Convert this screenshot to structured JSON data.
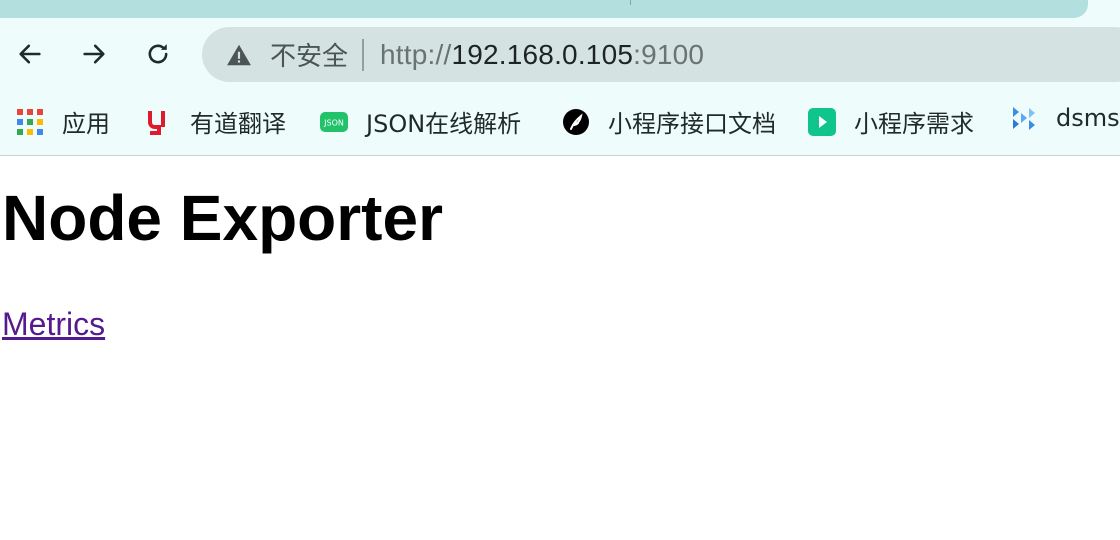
{
  "browser": {
    "security_label": "不安全",
    "url_scheme": "http://",
    "url_host": "192.168.0.105",
    "url_port": ":9100",
    "bookmarks": [
      {
        "label": "应用",
        "icon": "apps-grid-icon"
      },
      {
        "label": "有道翻译",
        "icon": "youdao-icon",
        "color": "#e0192e"
      },
      {
        "label": "JSON在线解析",
        "icon": "json-icon",
        "color": "#21c26a"
      },
      {
        "label": "小程序接口文档",
        "icon": "feather-icon",
        "color": "#000000"
      },
      {
        "label": "小程序需求",
        "icon": "play-icon",
        "color": "#0fc58c"
      },
      {
        "label": "dsms",
        "icon": "dsms-logo-icon",
        "color": "#3b8ee8"
      }
    ]
  },
  "page": {
    "title": "Node Exporter",
    "link_label": "Metrics"
  },
  "colors": {
    "tabstrip": "#b3dfdf",
    "toolbar": "#effcfc",
    "omnibox": "#d4e2e2",
    "visited_link": "#551a8b"
  }
}
